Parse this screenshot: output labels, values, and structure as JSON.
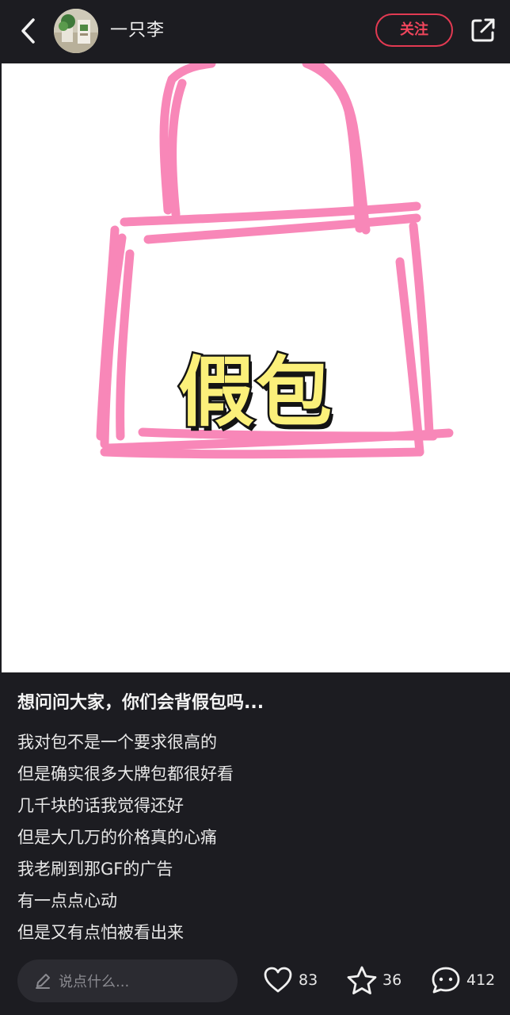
{
  "header": {
    "author_name": "一只李",
    "follow_label": "关注"
  },
  "image": {
    "label": "假包",
    "bag_color": "#f887b8",
    "label_color": "#fbf07a"
  },
  "note": {
    "title": "想问问大家，你们会背假包吗...",
    "lines": [
      "我对包不是一个要求很高的",
      "但是确实很多大牌包都很好看",
      "几千块的话我觉得还好",
      "但是大几万的价格真的心痛",
      "我老刷到那GF的广告",
      "有一点点心动",
      "但是又有点怕被看出来"
    ]
  },
  "bottom": {
    "comment_placeholder": "说点什么...",
    "like_count": "83",
    "favorite_count": "36",
    "comment_count": "412"
  },
  "icons": {
    "back": "chevron-left-icon",
    "share": "share-icon",
    "pen": "pen-icon",
    "like": "heart-icon",
    "favorite": "star-icon",
    "comment": "comment-bubble-icon"
  },
  "colors": {
    "background": "#1c1c21",
    "accent": "#e23a52"
  }
}
